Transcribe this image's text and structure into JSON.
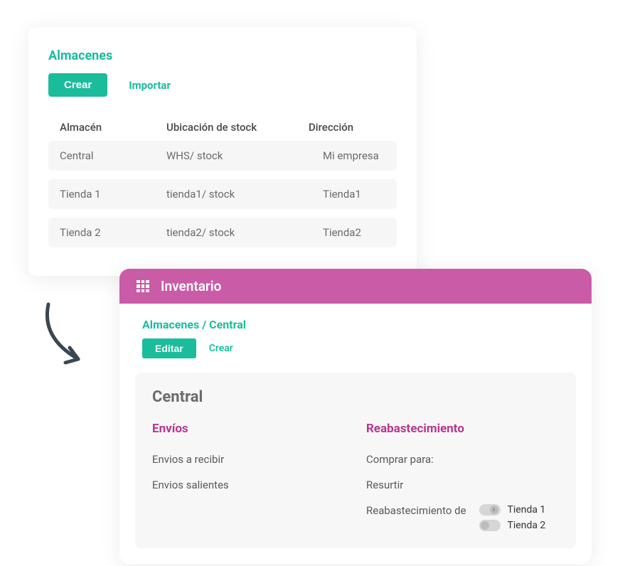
{
  "top": {
    "title": "Almacenes",
    "create_btn": "Crear",
    "import_btn": "Importar",
    "headers": {
      "col1": "Almacén",
      "col2": "Ubicación de stock",
      "col3": "Dirección"
    },
    "rows": [
      {
        "name": "Central",
        "location": "WHS/ stock",
        "address": "Mi empresa"
      },
      {
        "name": "Tienda 1",
        "location": "tienda1/ stock",
        "address": "Tienda1"
      },
      {
        "name": "Tienda 2",
        "location": "tienda2/ stock",
        "address": "Tienda2"
      }
    ]
  },
  "bottom": {
    "header": "Inventario",
    "breadcrumb": "Almacenes / Central",
    "edit_btn": "Editar",
    "create_link": "Crear",
    "panel_title": "Central",
    "envios": {
      "heading": "Envíos",
      "item1": "Envios a recibir",
      "item2": "Envios salientes"
    },
    "reab": {
      "heading": "Reabastecimiento",
      "item1": "Comprar para:",
      "item2": "Resurtir",
      "item3_label": "Reabastecimiento de",
      "toggles": [
        {
          "label": "Tienda 1",
          "on": true,
          "knob": "x"
        },
        {
          "label": "Tienda 2",
          "on": false,
          "knob": ""
        }
      ]
    }
  }
}
